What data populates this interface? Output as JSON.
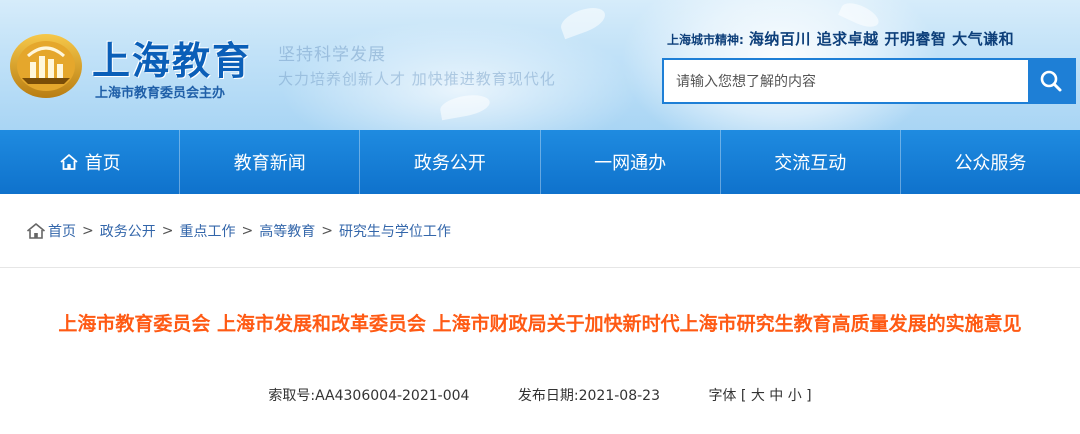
{
  "header": {
    "site_title": "上海教育",
    "site_subtitle": "上海市教育委员会主办",
    "slogan_line1": "坚持科学发展",
    "slogan_line2": "大力培养创新人才 加快推进教育现代化",
    "spirit_label": "上海城市精神:",
    "spirit_value": "海纳百川 追求卓越 开明睿智 大气谦和",
    "logo_icon": "shanghai-education-emblem",
    "search": {
      "placeholder": "请输入您想了解的内容",
      "value": "",
      "button_icon": "search-icon"
    }
  },
  "nav": {
    "items": [
      {
        "label": "首页",
        "icon": "home-icon"
      },
      {
        "label": "教育新闻"
      },
      {
        "label": "政务公开"
      },
      {
        "label": "一网通办"
      },
      {
        "label": "交流互动"
      },
      {
        "label": "公众服务"
      }
    ]
  },
  "breadcrumb": {
    "items": [
      "首页",
      "政务公开",
      "重点工作",
      "高等教育",
      "研究生与学位工作"
    ],
    "separator": ">"
  },
  "article": {
    "title": "上海市教育委员会 上海市发展和改革委员会 上海市财政局关于加快新时代上海市研究生教育高质量发展的实施意见",
    "index_label": "索取号:",
    "index_value": "AA4306004-2021-004",
    "date_label": "发布日期:",
    "date_value": "2021-08-23",
    "font_label": "字体",
    "font_large": "大",
    "font_medium": "中",
    "font_small": "小"
  },
  "colors": {
    "brand_blue": "#0b5fb8",
    "nav_blue": "#1479d4",
    "title_orange": "#ff5a14"
  }
}
